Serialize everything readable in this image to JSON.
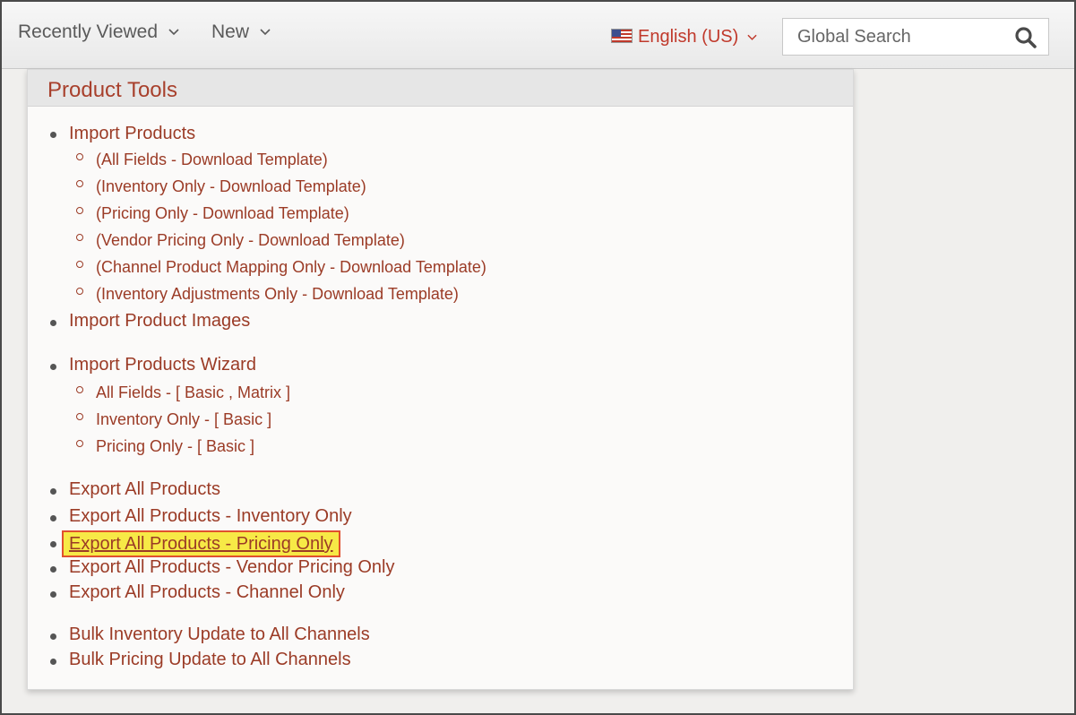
{
  "topbar": {
    "recently_viewed": "Recently Viewed",
    "new": "New",
    "language": "English (US)",
    "search_placeholder": "Global Search"
  },
  "panel": {
    "title": "Product Tools",
    "items": [
      {
        "label": "Import Products"
      },
      {
        "label": "(All Fields - Download Template)"
      },
      {
        "label": "(Inventory Only - Download Template)"
      },
      {
        "label": "(Pricing Only - Download Template)"
      },
      {
        "label": "(Vendor Pricing Only - Download Template)"
      },
      {
        "label": "(Channel Product Mapping Only - Download Template)"
      },
      {
        "label": "(Inventory Adjustments Only - Download Template)"
      },
      {
        "label": "Import Product Images"
      },
      {
        "label": "Import Products Wizard"
      },
      {
        "label": "All Fields - [ Basic , Matrix ]"
      },
      {
        "label": "Inventory Only - [ Basic ]"
      },
      {
        "label": "Pricing Only - [ Basic ]"
      },
      {
        "label": "Export All Products"
      },
      {
        "label": "Export All Products - Inventory Only"
      },
      {
        "label": "Export All Products - Pricing Only"
      },
      {
        "label": "Export All Products - Vendor Pricing Only"
      },
      {
        "label": "Export All Products - Channel Only"
      },
      {
        "label": "Bulk Inventory Update to All Channels"
      },
      {
        "label": "Bulk Pricing Update to All Channels"
      }
    ]
  }
}
